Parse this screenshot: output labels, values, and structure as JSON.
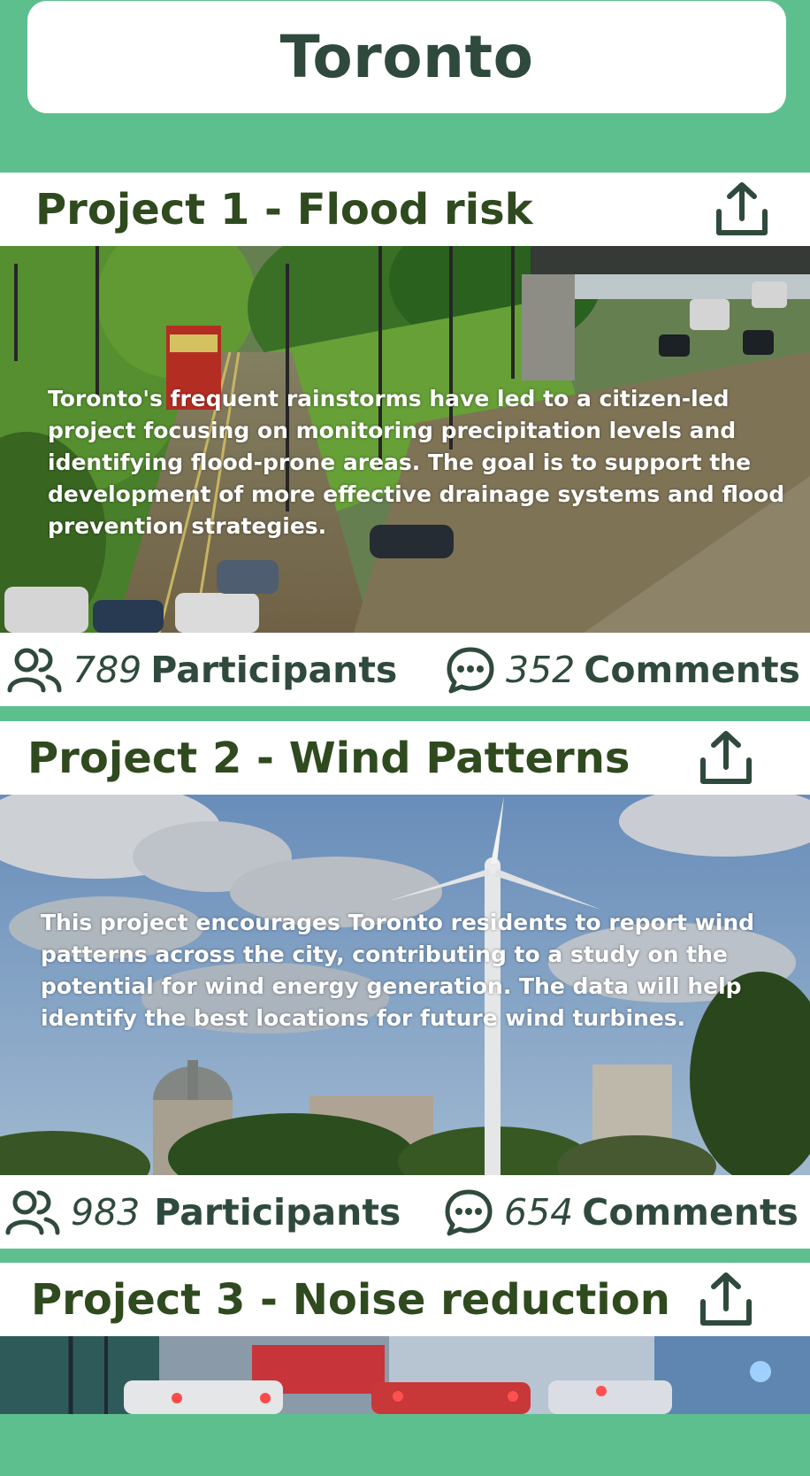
{
  "city": {
    "name": "Toronto"
  },
  "projects": [
    {
      "title": "Project 1 - Flood risk",
      "description": "Toronto's frequent rainstorms have led to a citizen-led project focusing on monitoring precipitation levels and identifying flood-prone areas. The goal is to support the development of more effective drainage systems and flood prevention strategies.",
      "participants_count": "789",
      "participants_label": "Participants",
      "comments_count": "352",
      "comments_label": "Comments"
    },
    {
      "title": "Project 2 - Wind Patterns",
      "description": "This project encourages Toronto residents to report wind patterns across the city, contributing to a study on the potential for wind energy generation. The data will help identify the best locations for future wind turbines.",
      "participants_count": "983",
      "participants_label": "Participants",
      "comments_count": "654",
      "comments_label": "Comments"
    },
    {
      "title": "Project 3 - Noise reduction"
    }
  ],
  "icons": {
    "share": "share-icon",
    "participants": "people-icon",
    "comments": "chat-bubble-icon"
  },
  "colors": {
    "background": "#5dbf8e",
    "text_dark": "#2f4a3c",
    "card": "#ffffff"
  }
}
